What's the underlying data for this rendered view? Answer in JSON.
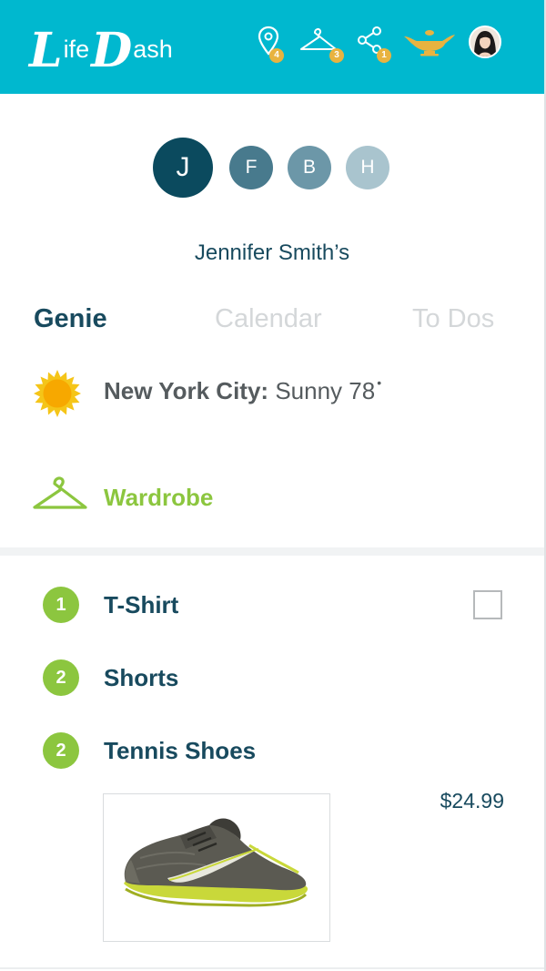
{
  "app": {
    "logo_initial_1": "L",
    "logo_text_1": "ife",
    "logo_initial_2": "D",
    "logo_text_2": "ash",
    "brand_color": "#00b8cf"
  },
  "header_icons": [
    {
      "name": "location-pin-icon",
      "badge": "4"
    },
    {
      "name": "hanger-icon",
      "badge": "3"
    },
    {
      "name": "share-icon",
      "badge": "1"
    },
    {
      "name": "genie-lamp-icon",
      "badge": ""
    },
    {
      "name": "user-avatar",
      "badge": ""
    }
  ],
  "profiles": [
    {
      "initial": "J",
      "selected": true,
      "color": "#0b4a5e"
    },
    {
      "initial": "F",
      "selected": false,
      "color": "#487a8d"
    },
    {
      "initial": "B",
      "selected": false,
      "color": "#6c97a8"
    },
    {
      "initial": "H",
      "selected": false,
      "color": "#a9c4ce"
    }
  ],
  "owner_name": "Jennifer Smith’s",
  "tabs": [
    {
      "label": "Genie",
      "active": true
    },
    {
      "label": "Calendar",
      "active": false
    },
    {
      "label": "To Dos",
      "active": false
    }
  ],
  "weather": {
    "city": "New York City:",
    "condition": "Sunny 78",
    "degree_symbol": "•",
    "icon": "sun-icon"
  },
  "wardrobe": {
    "label": "Wardrobe",
    "icon": "hanger-icon",
    "accent": "#8cc63f"
  },
  "items": [
    {
      "count": "1",
      "label": "T-Shirt"
    },
    {
      "count": "2",
      "label": "Shorts"
    },
    {
      "count": "2",
      "label": "Tennis Shoes"
    }
  ],
  "product": {
    "price": "$24.99",
    "image": "tennis-shoe-image"
  }
}
